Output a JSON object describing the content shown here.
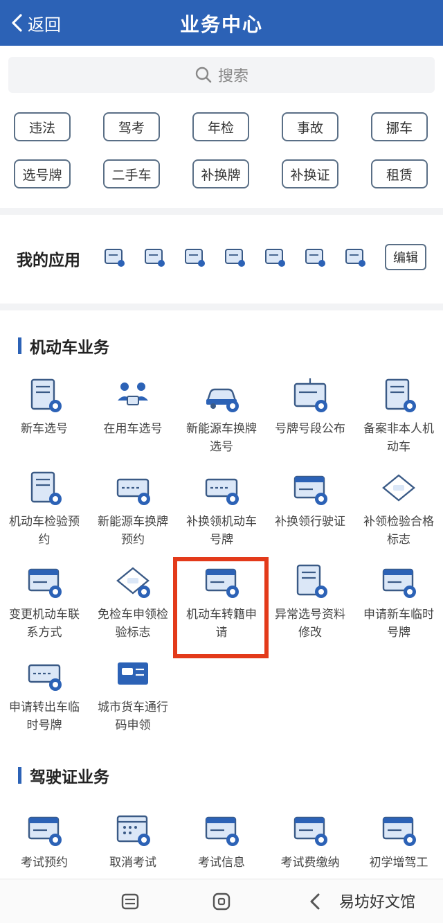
{
  "header": {
    "back_label": "返回",
    "title": "业务中心"
  },
  "search": {
    "placeholder": "搜索"
  },
  "tags": [
    "违法",
    "驾考",
    "年检",
    "事故",
    "挪车",
    "选号牌",
    "二手车",
    "补换牌",
    "补换证",
    "租赁"
  ],
  "my_apps": {
    "label": "我的应用",
    "icons": [
      "car-plus-icon",
      "document-plus-icon",
      "form-icon",
      "car-refresh-icon",
      "license-plate-icon",
      "list-icon",
      "id-card-icon"
    ],
    "edit_label": "编辑"
  },
  "motor_section": {
    "title": "机动车业务",
    "items": [
      {
        "label": "新车选号",
        "icon": "new-car-select-icon"
      },
      {
        "label": "在用车选号",
        "icon": "used-car-select-icon"
      },
      {
        "label": "新能源车换牌选号",
        "icon": "ev-car-icon"
      },
      {
        "label": "号牌号段公布",
        "icon": "plate-range-board-icon"
      },
      {
        "label": "备案非本人机动车",
        "icon": "record-document-icon"
      },
      {
        "label": "机动车检验预约",
        "icon": "inspection-booking-icon"
      },
      {
        "label": "新能源车换牌预约",
        "icon": "ev-plate-booking-icon"
      },
      {
        "label": "补换领机动车号牌",
        "icon": "replace-plate-icon"
      },
      {
        "label": "补换领行驶证",
        "icon": "replace-license-icon"
      },
      {
        "label": "补领检验合格标志",
        "icon": "inspection-mark-icon"
      },
      {
        "label": "变更机动车联系方式",
        "icon": "change-contact-icon"
      },
      {
        "label": "免检车申领检验标志",
        "icon": "exempt-mark-icon"
      },
      {
        "label": "机动车转籍申请",
        "icon": "transfer-registration-icon"
      },
      {
        "label": "异常选号资料修改",
        "icon": "edit-info-icon"
      },
      {
        "label": "申请新车临时号牌",
        "icon": "temp-plate-icon"
      },
      {
        "label": "申请转出车临时号牌",
        "icon": "transfer-out-plate-icon"
      },
      {
        "label": "城市货车通行码申领",
        "icon": "truck-pass-icon"
      }
    ]
  },
  "license_section": {
    "title": "驾驶证业务",
    "items": [
      {
        "label": "考试预约",
        "icon": "exam-booking-icon"
      },
      {
        "label": "取消考试",
        "icon": "cancel-exam-icon"
      },
      {
        "label": "考试信息",
        "icon": "exam-info-icon"
      },
      {
        "label": "考试费缴纳",
        "icon": "exam-fee-icon"
      },
      {
        "label": "初学增驾工",
        "icon": "beginner-license-icon"
      }
    ]
  },
  "watermark": "易坊好文馆",
  "colors": {
    "primary": "#2c62b6",
    "highlight": "#e33a1a",
    "tag_border": "#5a6f86",
    "icon_dark": "#3a5a86",
    "icon_light": "#dbe7f7"
  }
}
